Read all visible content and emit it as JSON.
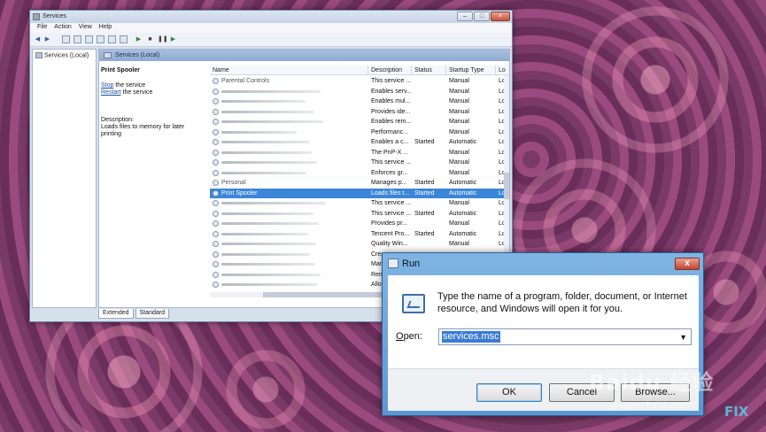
{
  "services": {
    "title": "Services",
    "menu": [
      "File",
      "Action",
      "View",
      "Help"
    ],
    "tree_root": "Services (Local)",
    "panel_title": "Services (Local)",
    "selected_service": "Print Spooler",
    "stop_link": "Stop",
    "stop_rest": " the service",
    "restart_link": "Restart",
    "restart_rest": " the service",
    "description_label": "Description:",
    "description_text": "Loads files to memory for later printing",
    "columns": [
      "Name",
      "Description",
      "Status",
      "Startup Type",
      "Lo"
    ],
    "rows": [
      {
        "name": "Parental Controls",
        "desc": "This service ...",
        "status": "",
        "startup": "Manual",
        "log": "Lo"
      },
      {
        "name": "",
        "desc": "Enables serv...",
        "status": "",
        "startup": "Manual",
        "log": "Lo"
      },
      {
        "name": "",
        "desc": "Enables mul...",
        "status": "",
        "startup": "Manual",
        "log": "Lo"
      },
      {
        "name": "",
        "desc": "Provides ide...",
        "status": "",
        "startup": "Manual",
        "log": "Lo"
      },
      {
        "name": "",
        "desc": "Enables rem...",
        "status": "",
        "startup": "Manual",
        "log": "Lo"
      },
      {
        "name": "",
        "desc": "Performanc...",
        "status": "",
        "startup": "Manual",
        "log": "Lo"
      },
      {
        "name": "",
        "desc": "Enables a c...",
        "status": "Started",
        "startup": "Automatic",
        "log": "Lo"
      },
      {
        "name": "",
        "desc": "The PnP-X ...",
        "status": "",
        "startup": "Manual",
        "log": "Lo"
      },
      {
        "name": "",
        "desc": "This service ...",
        "status": "",
        "startup": "Manual",
        "log": "Lo"
      },
      {
        "name": "",
        "desc": "Enforces gr...",
        "status": "",
        "startup": "Manual",
        "log": "Lo"
      },
      {
        "name": "Personal",
        "desc": "Manages p...",
        "status": "Started",
        "startup": "Automatic",
        "log": "Lo"
      },
      {
        "name": "Print Spooler",
        "desc": "Loads files t...",
        "status": "Started",
        "startup": "Automatic",
        "log": "Lo",
        "selected": true
      },
      {
        "name": "",
        "desc": "This service ...",
        "status": "",
        "startup": "Manual",
        "log": "Lo"
      },
      {
        "name": "",
        "desc": "This service ...",
        "status": "Started",
        "startup": "Automatic",
        "log": "Lo"
      },
      {
        "name": "",
        "desc": "Provides pr...",
        "status": "",
        "startup": "Manual",
        "log": "Lo"
      },
      {
        "name": "",
        "desc": "Tencent Pro...",
        "status": "Started",
        "startup": "Automatic",
        "log": "Lo"
      },
      {
        "name": "",
        "desc": "Quality Win...",
        "status": "",
        "startup": "Manual",
        "log": "Lo"
      },
      {
        "name": "",
        "desc": "Crea",
        "status": "",
        "startup": "",
        "log": ""
      },
      {
        "name": "",
        "desc": "Mar",
        "status": "",
        "startup": "",
        "log": ""
      },
      {
        "name": "",
        "desc": "Rem",
        "status": "",
        "startup": "",
        "log": ""
      },
      {
        "name": "",
        "desc": "Allo",
        "status": "",
        "startup": "",
        "log": ""
      }
    ],
    "tabs": [
      "Extended",
      "Standard"
    ]
  },
  "run": {
    "title": "Run",
    "close_glyph": "x",
    "message": "Type the name of a program, folder, document, or Internet resource, and Windows will open it for you.",
    "open_label_u": "O",
    "open_label_rest": "pen:",
    "open_value": "services.msc",
    "ok": "OK",
    "cancel": "Cancel",
    "browse": "Browse..."
  },
  "watermark": {
    "baidu": "Baidu 经验",
    "url": "jingyan.baidu.com",
    "fix": "FIX"
  }
}
